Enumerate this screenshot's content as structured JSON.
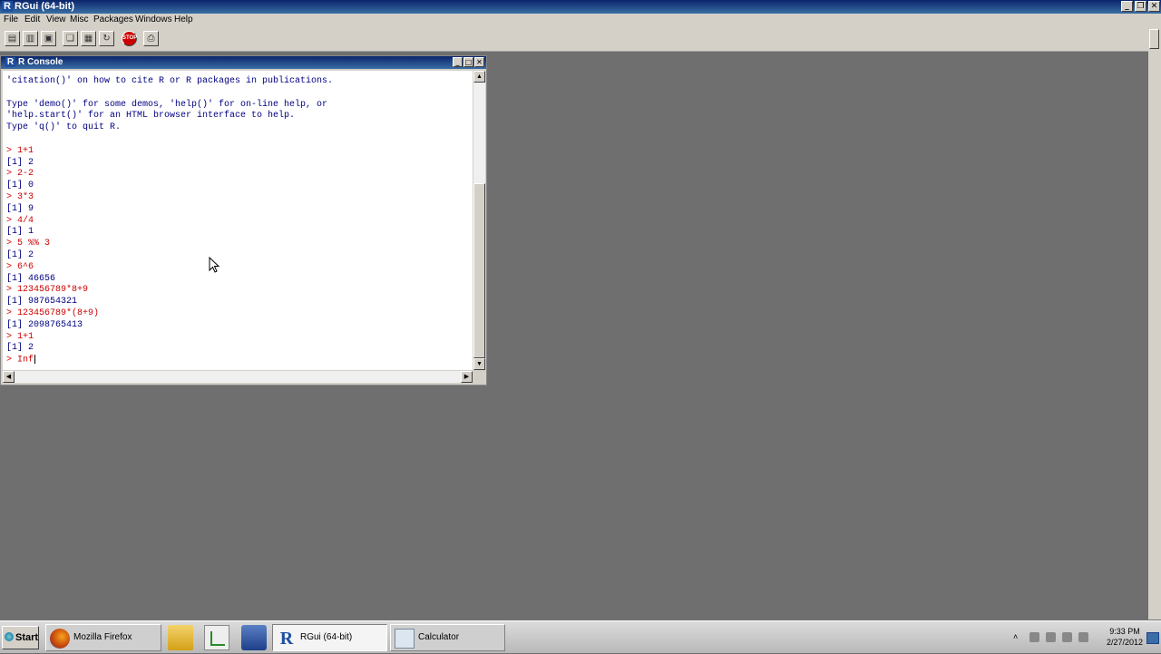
{
  "app": {
    "title": "RGui (64-bit)"
  },
  "menu": [
    "File",
    "Edit",
    "View",
    "Misc",
    "Packages",
    "Windows",
    "Help"
  ],
  "toolbar": {
    "icons": [
      "open-script-icon",
      "load-workspace-icon",
      "save-workspace-icon",
      "copy-icon",
      "paste-icon",
      "copy-paste-icon",
      "stop-icon",
      "print-icon"
    ],
    "stop_label": "STOP"
  },
  "console": {
    "title": "R Console",
    "lines": [
      {
        "text": "'citation()' on how to cite R or R packages in publications.",
        "kind": "out"
      },
      {
        "text": "",
        "kind": "out"
      },
      {
        "text": "Type 'demo()' for some demos, 'help()' for on-line help, or",
        "kind": "out"
      },
      {
        "text": "'help.start()' for an HTML browser interface to help.",
        "kind": "out"
      },
      {
        "text": "Type 'q()' to quit R.",
        "kind": "out"
      },
      {
        "text": "",
        "kind": "out"
      },
      {
        "text": "> 1+1",
        "kind": "cmd"
      },
      {
        "text": "[1] 2",
        "kind": "out"
      },
      {
        "text": "> 2-2",
        "kind": "cmd"
      },
      {
        "text": "[1] 0",
        "kind": "out"
      },
      {
        "text": "> 3*3",
        "kind": "cmd"
      },
      {
        "text": "[1] 9",
        "kind": "out"
      },
      {
        "text": "> 4/4",
        "kind": "cmd"
      },
      {
        "text": "[1] 1",
        "kind": "out"
      },
      {
        "text": "> 5 %% 3",
        "kind": "cmd"
      },
      {
        "text": "[1] 2",
        "kind": "out"
      },
      {
        "text": "> 6^6",
        "kind": "cmd"
      },
      {
        "text": "[1] 46656",
        "kind": "out"
      },
      {
        "text": "> 123456789*8+9",
        "kind": "cmd"
      },
      {
        "text": "[1] 987654321",
        "kind": "out"
      },
      {
        "text": "> 123456789*(8+9)",
        "kind": "cmd"
      },
      {
        "text": "[1] 2098765413",
        "kind": "out"
      },
      {
        "text": "> 1+1",
        "kind": "cmd"
      },
      {
        "text": "[1] 2",
        "kind": "out"
      }
    ],
    "current_input": "> Inf"
  },
  "taskbar": {
    "start_label": "Start",
    "tasks": [
      {
        "label": "Mozilla Firefox",
        "icon": "firefox-icon",
        "active": false
      },
      {
        "label": "RGui (64-bit)",
        "icon": "r-icon",
        "active": true
      },
      {
        "label": "Calculator",
        "icon": "calculator-icon",
        "active": false
      }
    ],
    "quick_launch": [
      "folder-icon",
      "chart-icon",
      "tool-icon"
    ],
    "clock_time": "9:33 PM",
    "clock_date": "2/27/2012"
  }
}
